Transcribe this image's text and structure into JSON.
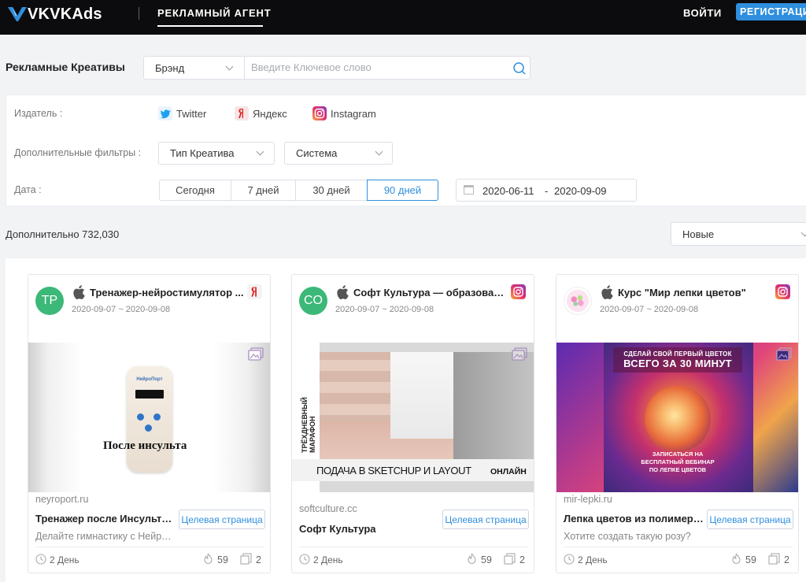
{
  "nav": {
    "logo_text": "VKVKAds",
    "tab_label": "РЕКЛАМНЫЙ АГЕНТ",
    "login_label": "ВОЙТИ",
    "register_label": "РЕГИСТРАЦИ"
  },
  "search": {
    "title": "Рекламные Креативы",
    "brand_select": "Брэнд",
    "placeholder": "Введите Ключевое слово",
    "value": ""
  },
  "filters": {
    "publisher_label": "Издатель :",
    "publishers": [
      {
        "name": "Twitter",
        "icon": "twitter-icon"
      },
      {
        "name": "Яндекс",
        "icon": "yandex-icon"
      },
      {
        "name": "Instagram",
        "icon": "instagram-icon"
      }
    ],
    "extra_label": "Дополнительные фильтры :",
    "creative_type": "Тип Креатива",
    "system": "Система",
    "date_label": "Дата :",
    "date_options": [
      "Сегодня",
      "7 дней",
      "30 дней",
      "90 дней"
    ],
    "date_active": "90 дней",
    "date_from": "2020-06-11",
    "date_sep": "-",
    "date_to": "2020-09-09"
  },
  "results": {
    "count_text": "Дополнительно 732,030",
    "sort_value": "Новые"
  },
  "colors": {
    "accent": "#2f8fde",
    "avatar_green": "#3cb878"
  },
  "cards": [
    {
      "avatar": "TP",
      "title": "Тренажер-нейростимулятор ...",
      "platform_icon": "apple-icon",
      "publisher_icon": "yandex-icon",
      "dates": "2020-09-07 ~ 2020-09-08",
      "creative_text": "После инсульта",
      "device_brand": "НейроПорт",
      "domain": "neyroport.ru",
      "ad_title": "Тренажер после Инсульта ...",
      "ad_desc": "Делайте гимнастику с Нейропортом",
      "landing_label": "Целевая страница",
      "age": "2 День",
      "likes": "59",
      "copies": "2"
    },
    {
      "avatar": "CO",
      "title": "Софт Культура — образовательная платформа",
      "platform_icon": "apple-icon",
      "publisher_icon": "instagram-icon",
      "dates": "2020-09-07 ~ 2020-09-08",
      "creative_vertical": "ТРЁХДНЕВНЫЙ МАРАФОН",
      "creative_main": "ПОДАЧА В SKETCHUP И LAYOUT",
      "creative_online": "ОНЛАЙН",
      "domain": "softculture.cc",
      "ad_title": "Софт Культура",
      "ad_desc": "",
      "landing_label": "Целевая страница",
      "age": "2 День",
      "likes": "59",
      "copies": "2"
    },
    {
      "avatar": "",
      "title": "Курс \"Мир лепки цветов\"",
      "platform_icon": "apple-icon",
      "publisher_icon": "instagram-icon",
      "dates": "2020-09-07 ~ 2020-09-08",
      "creative_top1": "СДЕЛАЙ СВОЙ ПЕРВЫЙ ЦВЕТОК",
      "creative_top2": "ВСЕГО ЗА 30 МИНУТ",
      "creative_bottom": "ЗАПИСАТЬСЯ НА БЕСПЛАТНЫЙ ВЕБИНАР ПО ЛЕПКЕ ЦВЕТОВ",
      "domain": "mir-lepki.ru",
      "ad_title": "Лепка цветов из полимерной глины",
      "ad_desc": "Хотите создать такую розу?",
      "landing_label": "Целевая страница",
      "age": "2 День",
      "likes": "59",
      "copies": "2"
    }
  ]
}
